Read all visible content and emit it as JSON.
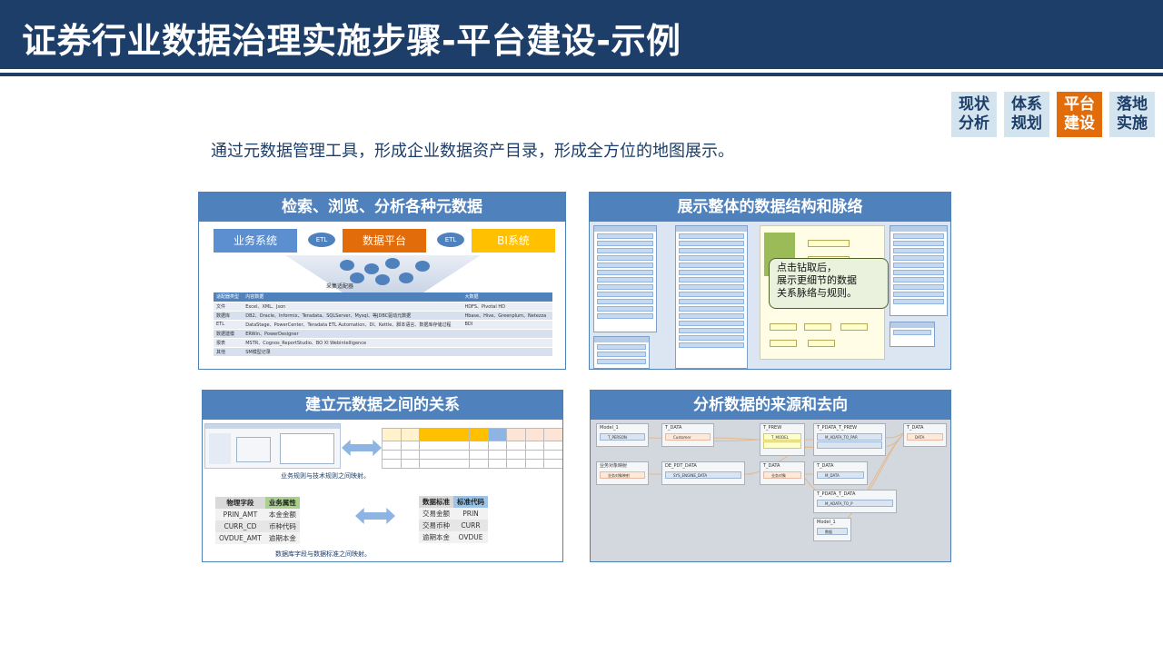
{
  "header": {
    "title": "证券行业数据治理实施步骤-平台建设-示例"
  },
  "steps": [
    {
      "label1": "现状",
      "label2": "分析",
      "active": false
    },
    {
      "label1": "体系",
      "label2": "规划",
      "active": false
    },
    {
      "label1": "平台",
      "label2": "建设",
      "active": true
    },
    {
      "label1": "落地",
      "label2": "实施",
      "active": false
    }
  ],
  "intro": "通过元数据管理工具，形成企业数据资产目录，形成全方位的地图展示。",
  "panels": {
    "p1": {
      "title": "检索、浏览、分析各种元数据",
      "biz": "业务系统",
      "etl1": "ETL",
      "platform": "数据平台",
      "etl2": "ETL",
      "bi": "BI系统",
      "adapter": "采集适配器",
      "table_head": [
        "适配器类型",
        "内容数据",
        "大数据"
      ],
      "table_rows": [
        [
          "文件",
          "Excel、XML、Json",
          "HDFS、Pivotal HD"
        ],
        [
          "数据库",
          "DB2、Oracle、Informix、Teradata、SQLServer、Mysql、等JDBC驱动元数据",
          "Hbase、Hive、Greenplum、Netezza"
        ],
        [
          "ETL",
          "DataStage、PowerCenter、Teradata ETL Automation、DI、Kettle、脚本语言、数据库存储过程",
          "BDI"
        ],
        [
          "数据建模",
          "ERWin、PowerDesigner",
          ""
        ],
        [
          "报表",
          "MSTR、Cognos_ReportStudio、BO XI Webintelligence",
          ""
        ],
        [
          "其他",
          "SM模型记录",
          ""
        ]
      ]
    },
    "p2": {
      "title": "展示整体的数据结构和脉络",
      "tip_line1": "点击钻取后，",
      "tip_line2": "展示更细节的数据",
      "tip_line3": "关系脉络与规则。"
    },
    "p3": {
      "title": "建立元数据之间的关系",
      "caption1": "业务规则与技术规则之间映射。",
      "caption2": "数据库字段与数据标准之间映射。",
      "left_head": [
        "物理字段",
        "业务属性"
      ],
      "left_rows": [
        [
          "PRIN_AMT",
          "本金金额"
        ],
        [
          "CURR_CD",
          "币种代码"
        ],
        [
          "OVDUE_AMT",
          "逾期本金"
        ]
      ],
      "right_head": [
        "数据标准",
        "标准代码"
      ],
      "right_rows": [
        [
          "交易金额",
          "PRIN"
        ],
        [
          "交易币种",
          "CURR"
        ],
        [
          "逾期本金",
          "OVDUE"
        ]
      ]
    },
    "p4": {
      "title": "分析数据的来源和去向",
      "nodes": [
        {
          "title": "Model_1",
          "row": "T_PERSON",
          "kind": "b"
        },
        {
          "title": "T_DATA",
          "row": "Customer",
          "kind": ""
        },
        {
          "title": "T_PREW",
          "row": "T_MODEL",
          "kind": "y"
        },
        {
          "title": "T_PDATA_T_PREW",
          "row": "M_ADATA_TO_PAR",
          "kind": "b"
        },
        {
          "title": "T_DATA",
          "row": "DATA",
          "kind": ""
        },
        {
          "title": "业务对象映射",
          "row": "业务对象映射",
          "kind": ""
        },
        {
          "title": "DE_PDT_DATA",
          "row": "SYS_ENGINE_DATA",
          "kind": "b"
        },
        {
          "title": "T_DATA",
          "row": "业务对象",
          "kind": ""
        },
        {
          "title": "T_DATA",
          "row": "M_DATA",
          "kind": "b"
        },
        {
          "title": "T_PDATA_T_DATA",
          "row": "M_ADATA_TO_P",
          "kind": "b"
        },
        {
          "title": "Model_1",
          "row": "数据",
          "kind": "b"
        }
      ]
    }
  }
}
